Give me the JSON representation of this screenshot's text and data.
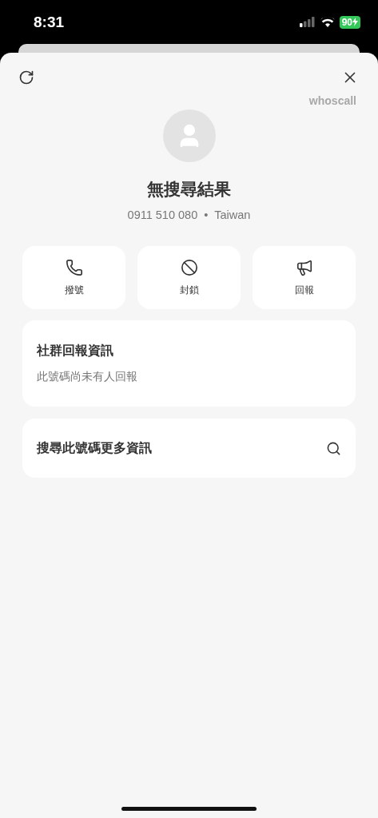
{
  "status_bar": {
    "time": "8:31",
    "battery": "90"
  },
  "header": {
    "brand": "whoscall"
  },
  "contact": {
    "name": "無搜尋結果",
    "number": "0911 510 080",
    "separator": "•",
    "region": "Taiwan"
  },
  "actions": [
    {
      "kind": "call",
      "label": "撥號"
    },
    {
      "kind": "block",
      "label": "封鎖"
    },
    {
      "kind": "report",
      "label": "回報"
    }
  ],
  "community": {
    "title": "社群回報資訊",
    "text": "此號碼尚未有人回報"
  },
  "search_more": {
    "label": "搜尋此號碼更多資訊"
  }
}
